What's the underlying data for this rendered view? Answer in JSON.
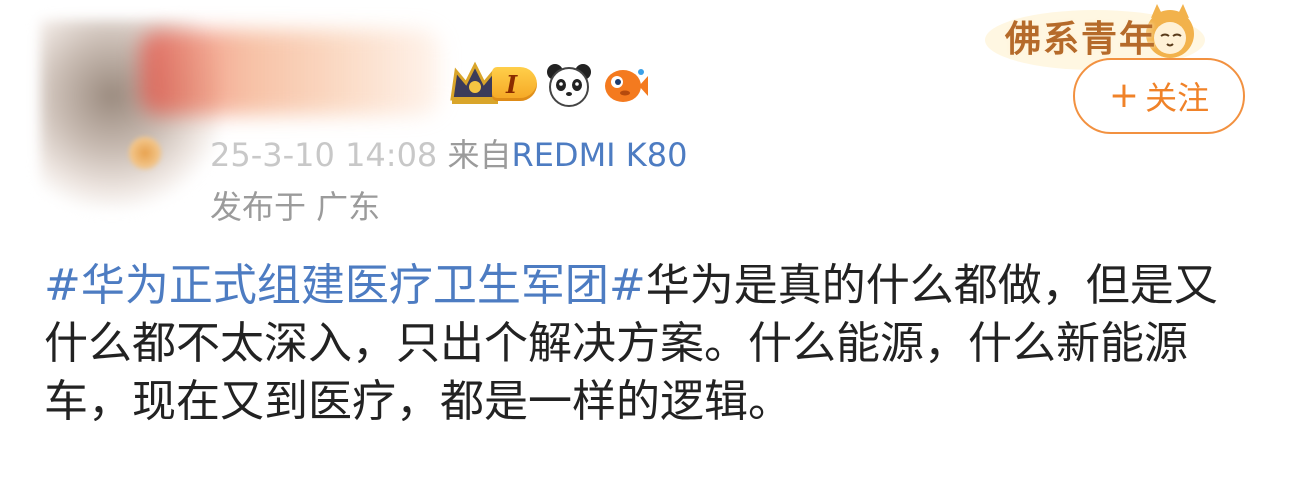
{
  "post": {
    "timestamp": "25-3-10 14:08",
    "source_prefix": "来自",
    "device": "REDMI K80",
    "location": "发布于 广东",
    "hashtag": "#华为正式组建医疗卫生军团#",
    "text": "华为是真的什么都做，但是又什么都不太深入，只出个解决方案。什么能源，什么新能源车，现在又到医疗，都是一样的逻辑。"
  },
  "user": {
    "level": "I"
  },
  "badges": [
    "crown-icon",
    "level-badge",
    "panda-icon",
    "fish-icon"
  ],
  "decoration": {
    "festive_text": "佛系青年"
  },
  "follow_button": {
    "plus": "+",
    "label": "关注"
  },
  "colors": {
    "link": "#4d7cc2",
    "accent": "#f08228",
    "text": "#222222",
    "meta": "#9b9b9b"
  }
}
